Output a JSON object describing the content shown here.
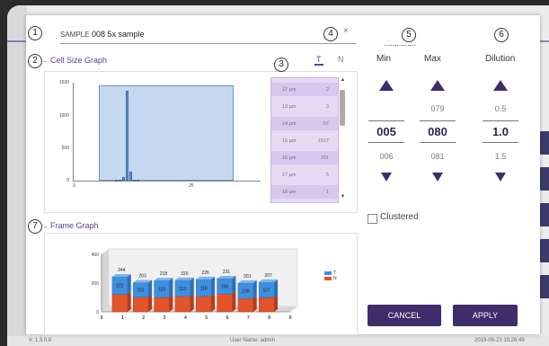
{
  "footer": {
    "version": "V. 1.3.0.8",
    "user": "User Name: admin",
    "datetime": "2019-09-23 15:28:49"
  },
  "markers": [
    "1",
    "2",
    "3",
    "4",
    "5",
    "6",
    "7"
  ],
  "sample": {
    "label": "SAMPLE",
    "value": "008 5x sample",
    "close": "×"
  },
  "cell_size_graph": {
    "title": "Cell Size Graph"
  },
  "frame_graph": {
    "title": "Frame Graph"
  },
  "tabs": {
    "t": "T",
    "n": "N"
  },
  "size_table": {
    "rows": [
      {
        "size": "12 µm",
        "count": "2"
      },
      {
        "size": "13 µm",
        "count": "3"
      },
      {
        "size": "14 µm",
        "count": "57"
      },
      {
        "size": "15 µm",
        "count": "1517"
      },
      {
        "size": "16 µm",
        "count": "151"
      },
      {
        "size": "17 µm",
        "count": "5"
      },
      {
        "size": "18 µm",
        "count": "1"
      }
    ]
  },
  "pickers": {
    "min": {
      "label": "Min",
      "prev": "",
      "current": "005",
      "next": "006"
    },
    "max": {
      "label": "Max",
      "prev": "079",
      "current": "080",
      "next": "081"
    },
    "dilution": {
      "label": "Dilution",
      "prev": "0.5",
      "current": "1.0",
      "next": "1.5"
    }
  },
  "clustered": {
    "label": "Clustered",
    "checked": false
  },
  "buttons": {
    "cancel": "CANCEL",
    "apply": "APPLY"
  },
  "colors": {
    "accent": "#3e2d6b",
    "title_purple": "#5d3f8e",
    "series_t": "#3f8fe0",
    "series_n": "#e2552a"
  },
  "chart_data": [
    {
      "type": "bar",
      "title": "Cell Size Graph",
      "x": [
        12,
        13,
        14,
        15,
        16,
        17,
        18
      ],
      "values": [
        2,
        3,
        57,
        1517,
        151,
        5,
        1
      ],
      "xticks": [
        "0",
        "25"
      ],
      "yticks": [
        "0",
        "500",
        "1000",
        "1500"
      ],
      "ylim": [
        0,
        1600
      ]
    },
    {
      "type": "bar",
      "title": "Frame Graph",
      "categories": [
        "0",
        "1",
        "2",
        "3",
        "4",
        "5",
        "6",
        "7",
        "8",
        "9"
      ],
      "bar_categories": [
        "1",
        "2",
        "3",
        "4",
        "5",
        "6",
        "7",
        "8"
      ],
      "series": [
        {
          "name": "T",
          "values": [
            122,
            101,
            118,
            113,
            118,
            106,
            108,
            107
          ]
        },
        {
          "name": "N",
          "values": [
            122,
            102,
            100,
            107,
            108,
            125,
            93,
            100
          ]
        }
      ],
      "totals": [
        244,
        203,
        218,
        220,
        226,
        231,
        201,
        207
      ],
      "yticks": [
        "0",
        "200",
        "400"
      ],
      "ylim": [
        0,
        400
      ]
    }
  ]
}
